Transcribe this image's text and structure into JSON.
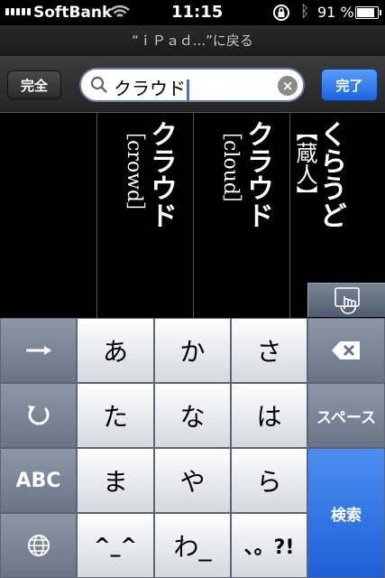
{
  "status_bar": {
    "carrier": "SoftBank",
    "time": "11:15",
    "battery_percent": "91 %",
    "battery_level": 0.91
  },
  "nav": {
    "back_label": "“ｉＰａｄ...”に戻る"
  },
  "search_bar": {
    "left_button": "完全",
    "query": "クラウド",
    "right_button": "完了"
  },
  "results": [
    {
      "word": "くらうど",
      "gloss": "【蔵人】"
    },
    {
      "word": "クラウド",
      "gloss": "［cloud］"
    },
    {
      "word": "クラウド",
      "gloss": "［crowd］"
    },
    {
      "word": "",
      "gloss": ""
    }
  ],
  "keyboard": {
    "row1": [
      "あ",
      "か",
      "さ"
    ],
    "row2": [
      "た",
      "な",
      "は"
    ],
    "row3": [
      "ま",
      "や",
      "ら"
    ],
    "row4": [
      "^_^",
      "わ_",
      "、。?!"
    ],
    "abc_label": "ABC",
    "space_label": "スペース",
    "search_label": "検索",
    "left_keys_icons": [
      "arrow-right-icon",
      "undo-icon",
      "abc",
      "globe-icon"
    ],
    "delete_icon": "backspace-icon"
  },
  "colors": {
    "accent_blue": "#1e5fd8",
    "caret": "#3b6fd6"
  }
}
